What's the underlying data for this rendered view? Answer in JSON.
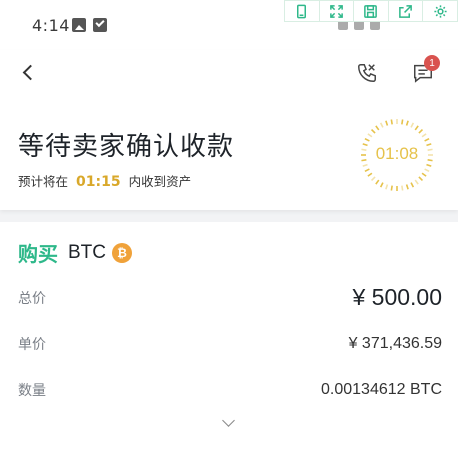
{
  "status_bar": {
    "time": "4:14"
  },
  "header": {
    "title": "等待卖家确认收款",
    "subtitle_prefix": "预计将在",
    "subtitle_time": "01:15",
    "subtitle_suffix": "内收到资产",
    "countdown": "01:08",
    "chat_badge": "1"
  },
  "order": {
    "action": "购买",
    "coin": "BTC",
    "coin_icon": "₿",
    "rows": [
      {
        "label": "总价",
        "value": "¥ 500.00"
      },
      {
        "label": "单价",
        "value": "¥ 371,436.59"
      },
      {
        "label": "数量",
        "value": "0.00134612 BTC"
      }
    ]
  },
  "colors": {
    "accent_green": "#2eb88a",
    "countdown_gold": "#e6c24a",
    "badge_red": "#d9534f",
    "btc_orange": "#f0a23a"
  }
}
